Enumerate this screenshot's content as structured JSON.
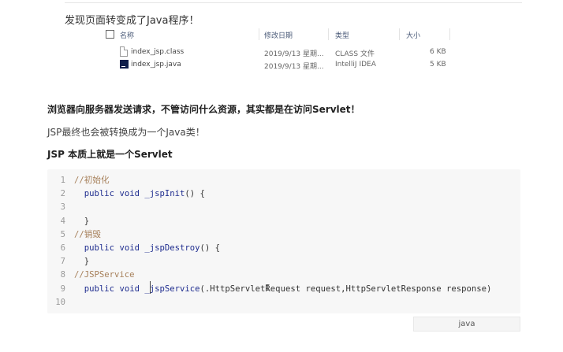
{
  "intro": "发现页面转变成了Java程序！",
  "explorer": {
    "columns": {
      "name": "名称",
      "modified": "修改日期",
      "type": "类型",
      "size": "大小"
    },
    "files": [
      {
        "name": "index_jsp.class",
        "modified": "2019/9/13 星期...",
        "type": "CLASS 文件",
        "size": "6 KB",
        "icon": "class-file-icon"
      },
      {
        "name": "index_jsp.java",
        "modified": "2019/9/13 星期...",
        "type": "IntelliJ IDEA",
        "size": "5 KB",
        "icon": "intellij-icon"
      }
    ]
  },
  "text": {
    "bold1": "浏览器向服务器发送请求，不管访问什么资源，其实都是在访问Servlet！",
    "para": "JSP最终也会被转换成为一个Java类！",
    "bold2": "JSP 本质上就是一个Servlet"
  },
  "code": {
    "line_numbers": [
      "1",
      "2",
      "3",
      "4",
      "5",
      "6",
      "7",
      "8",
      "9",
      "10"
    ],
    "lines": [
      "//初始化",
      "  public void _jspInit() {",
      "",
      "  }",
      "//销毁",
      "  public void _jspDestroy() {",
      "  }",
      "//JSPService",
      "  public void _jspService(.HttpServletRequest request,HttpServletResponse response)",
      ""
    ],
    "language": "java"
  },
  "colors": {
    "comment": "#a67f59",
    "keyword": "#1f2d8f",
    "code_bg": "#f7f7f7"
  }
}
